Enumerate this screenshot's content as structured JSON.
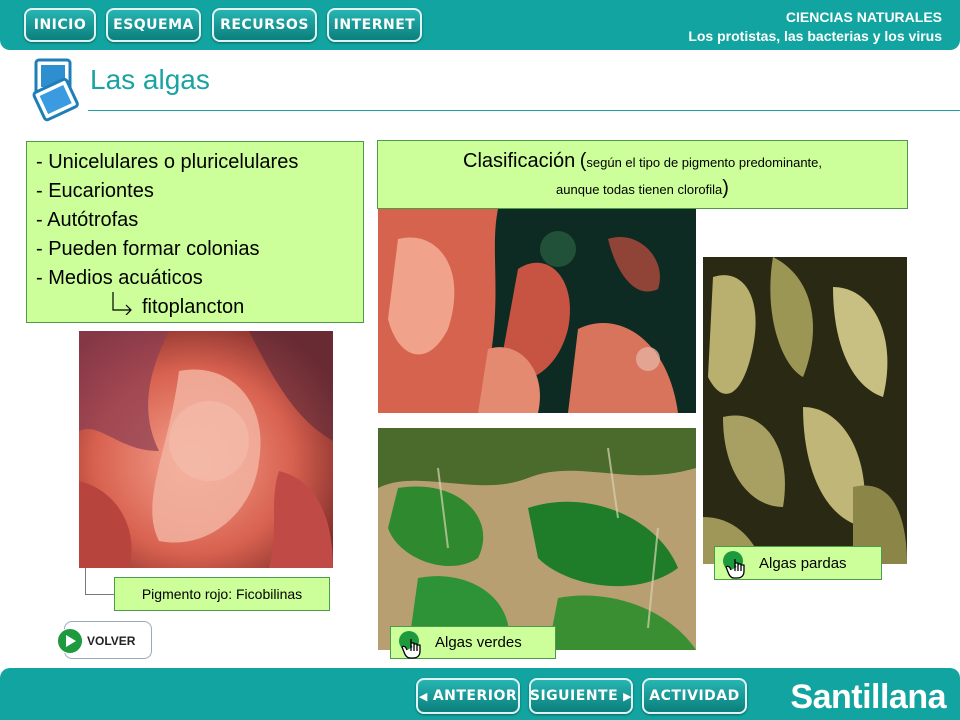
{
  "nav": {
    "inicio": "INICIO",
    "esquema": "ESQUEMA",
    "recursos": "RECURSOS",
    "internet": "INTERNET"
  },
  "subject": {
    "line1": "CIENCIAS NATURALES",
    "line2": "Los protistas, las bacterias y los virus"
  },
  "page_title": "Las algas",
  "features": [
    "- Unicelulares o pluricelulares",
    "- Eucariontes",
    "- Autótrofas",
    "- Pueden formar colonias",
    "- Medios acuáticos",
    "fitoplancton"
  ],
  "classification": {
    "title": "Clasificación",
    "paren_open": "(",
    "note_line1": "según el tipo de pigmento predominante,",
    "note_line2": "aunque todas tienen clorofila",
    "paren_close": ")"
  },
  "labels": {
    "red": "Pigmento rojo: Ficobilinas",
    "brown": "Algas pardas",
    "green": "Algas verdes"
  },
  "volver": "VOLVER",
  "bottom": {
    "anterior": "ANTERIOR",
    "siguiente": "SIGUIENTE",
    "actividad": "ACTIVIDAD",
    "brand": "Santillana"
  },
  "colors": {
    "teal": "#12a4a0",
    "label_green": "#ccff99"
  }
}
